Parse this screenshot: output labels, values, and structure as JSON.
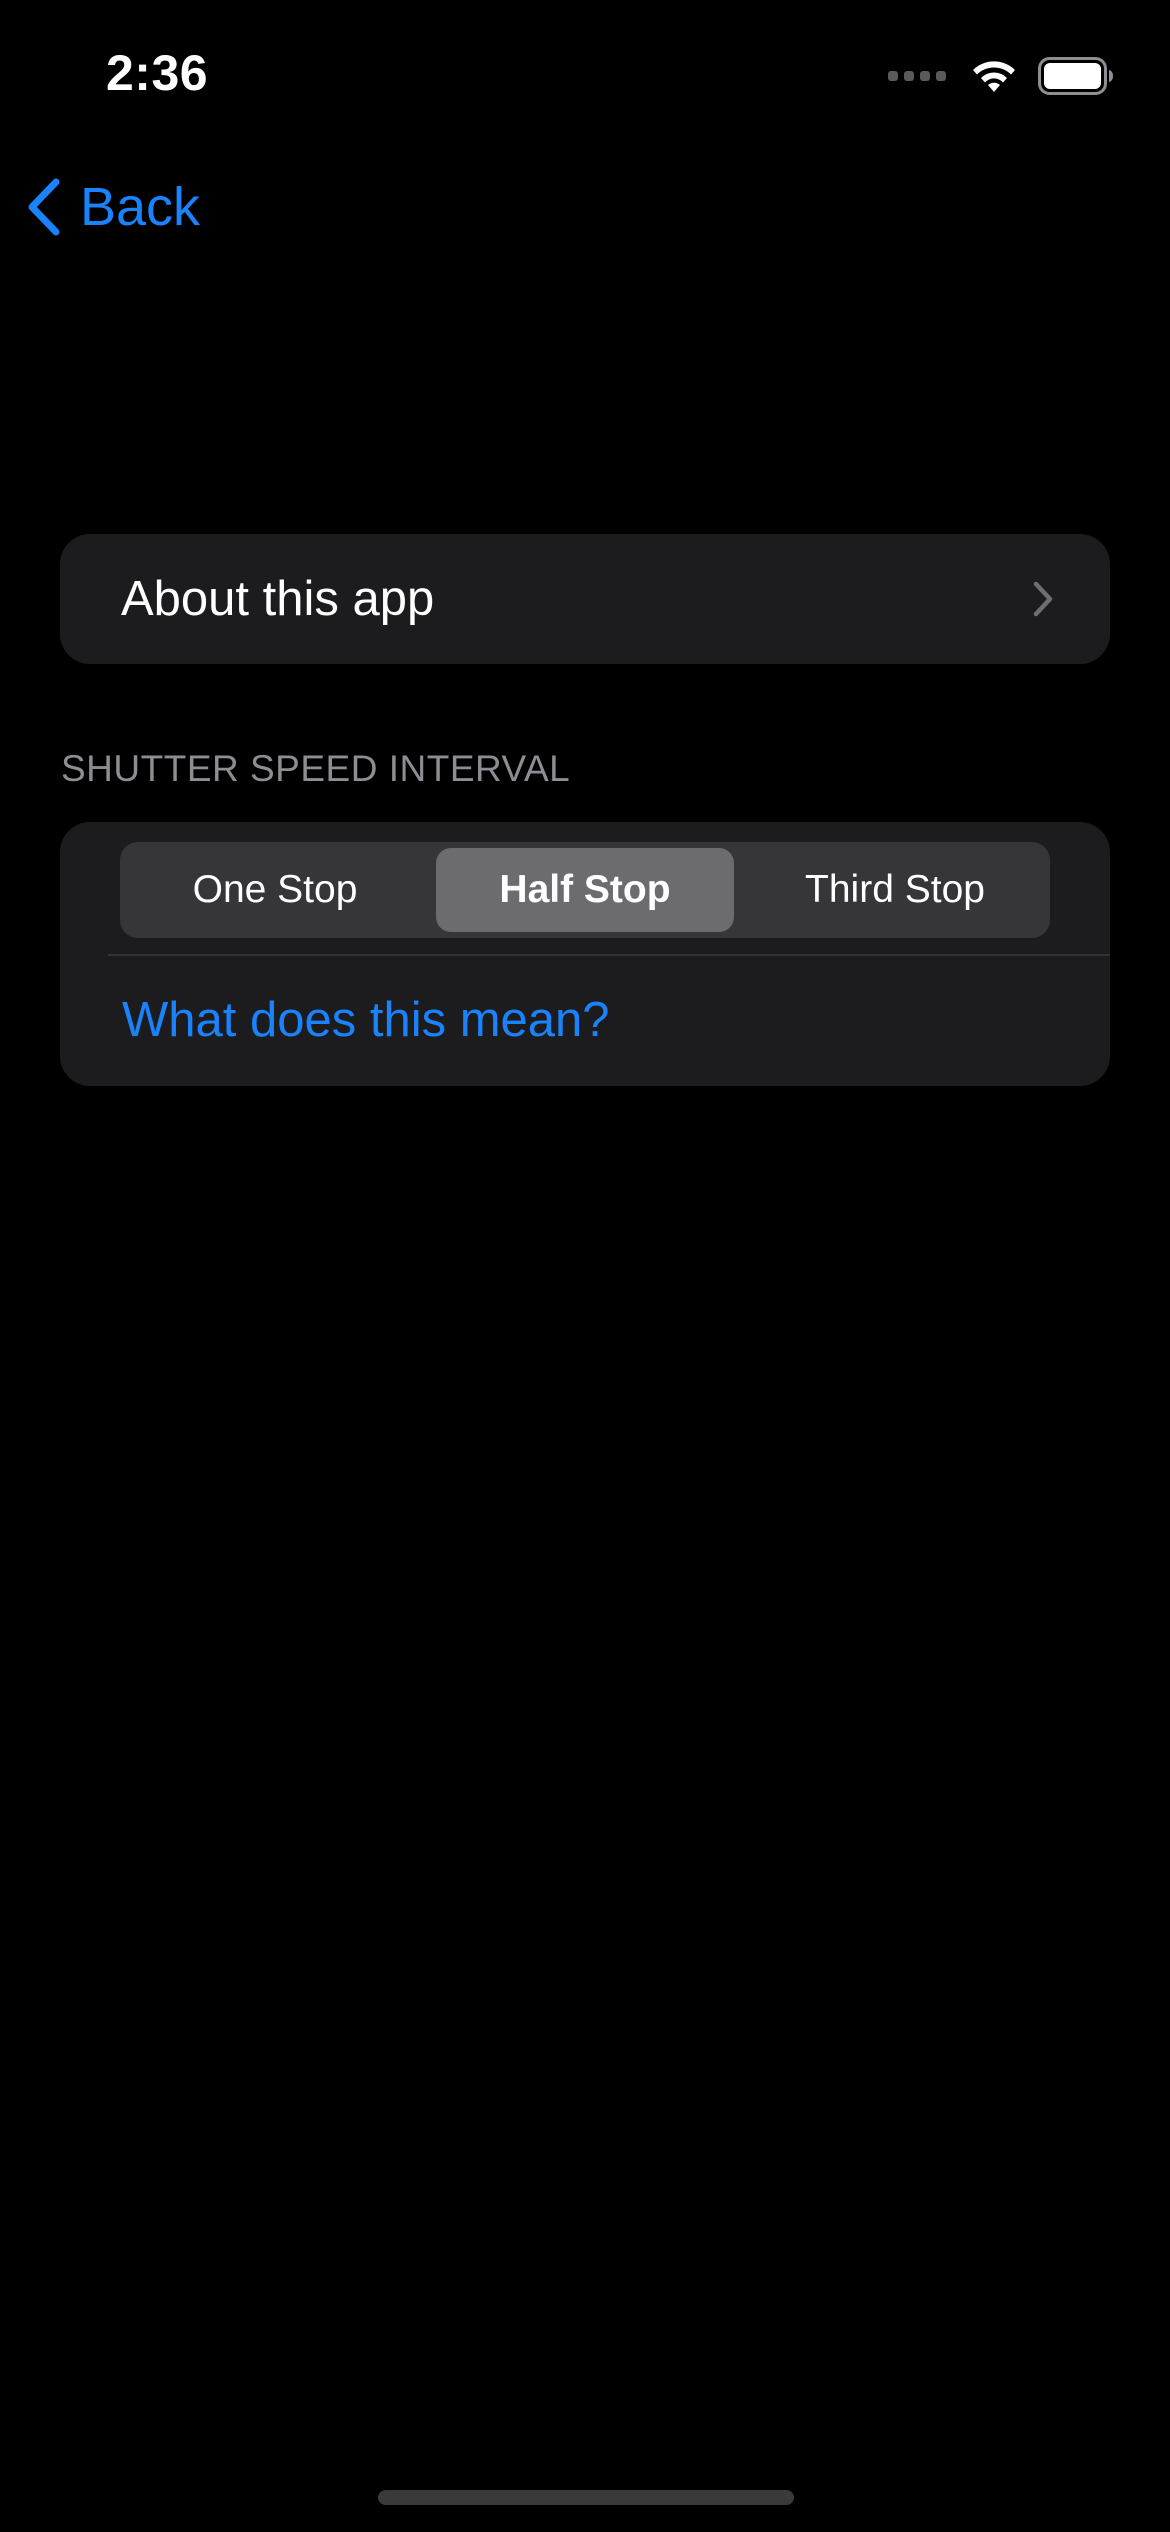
{
  "status_bar": {
    "time": "2:36",
    "icons": [
      "cellular-signal-icon",
      "wifi-icon",
      "battery-icon"
    ]
  },
  "nav": {
    "back_label": "Back",
    "back_icon": "chevron-left-icon"
  },
  "about": {
    "label": "About this app",
    "icon": "chevron-right-icon"
  },
  "shutter_interval": {
    "header": "SHUTTER SPEED INTERVAL",
    "options": [
      "One Stop",
      "Half Stop",
      "Third Stop"
    ],
    "selected": "Half Stop",
    "help_link": "What does this mean?"
  },
  "colors": {
    "accent": "#1a82fb",
    "background": "#000000",
    "card": "#1c1c1e",
    "secondary_text": "#8d8d93"
  }
}
